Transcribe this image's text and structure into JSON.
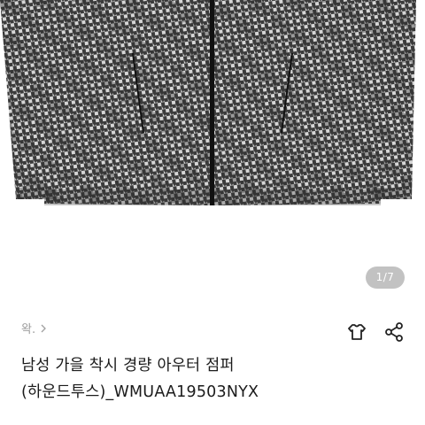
{
  "gallery": {
    "image_alt": "houndstooth zip-up jacket",
    "pager_text": "1/7",
    "colors": {
      "jacket_dark": "#3a3a3a",
      "jacket_light": "#d9d9d9",
      "zipper": "#111111"
    }
  },
  "product": {
    "category_label": "왁.",
    "title": "남성 가을 착시 경량 아우터 점퍼 (하운드투스)_WMUAA19503NYX"
  },
  "actions": {
    "icons": [
      "shirt-icon",
      "share-icon"
    ]
  }
}
